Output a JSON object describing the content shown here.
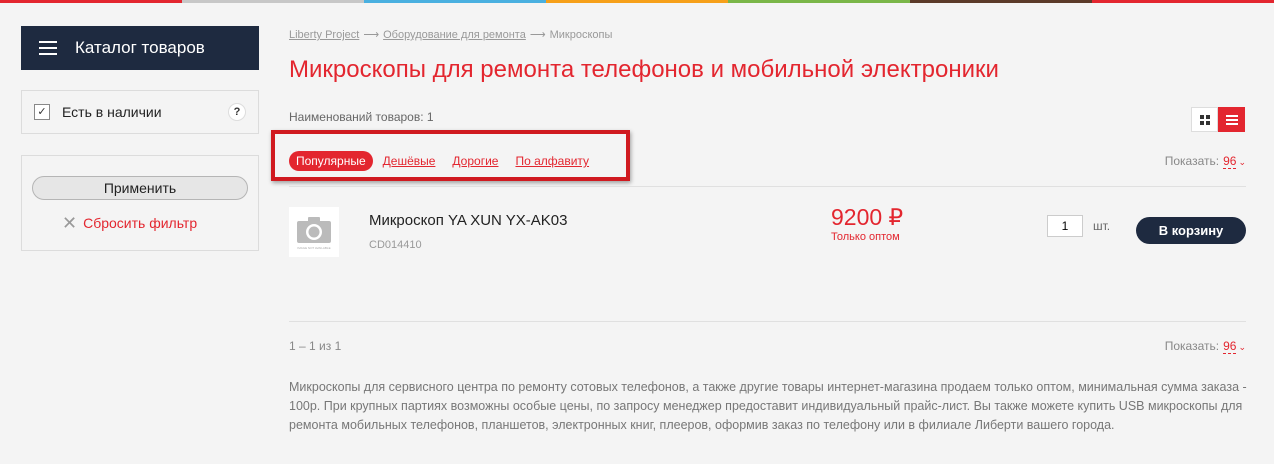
{
  "top_stripe_colors": [
    "#e3262f",
    "#c7c7c7",
    "#4ab0e0",
    "#f6a01a",
    "#7ab648",
    "#5b3a29",
    "#e3262f"
  ],
  "sidebar": {
    "catalog_label": "Каталог товаров",
    "in_stock_label": "Есть в наличии",
    "in_stock_checked": "✓",
    "help_label": "?",
    "apply_label": "Применить",
    "reset_label": "Сбросить фильтр"
  },
  "breadcrumb": {
    "items": [
      "Liberty Project",
      "Оборудование для ремонта",
      "Микроскопы"
    ],
    "separator": "⟶"
  },
  "page_title": "Микроскопы для ремонта телефонов и мобильной электроники",
  "product_count": "Наименований товаров: 1",
  "sort": {
    "active": "Популярные",
    "options": [
      "Дешёвые",
      "Дорогие",
      "По алфавиту"
    ]
  },
  "show": {
    "label": "Показать:",
    "value": "96",
    "chevron": "⌄"
  },
  "product": {
    "image_placeholder_text": "IMAGE NOT AVAILABLE",
    "name": "Микроскоп YA XUN YX-AK03",
    "code": "CD014410",
    "price": "9200 ₽",
    "wholesale_note": "Только оптом",
    "quantity": "1",
    "unit": "шт.",
    "cart_label": "В корзину"
  },
  "pager_text": "1 – 1 из 1",
  "description": "Микроскопы для сервисного центра по ремонту сотовых телефонов, а также другие товары интернет-магазина продаем только оптом, минимальная сумма заказа - 100р. При крупных партиях возможны особые цены, по запросу менеджер предоставит индивидуальный прайс-лист. Вы также можете купить USB микроскопы для ремонта мобильных телефонов, планшетов, электронных книг, плееров, оформив заказ по телефону или в филиале Либерти вашего города.",
  "colors": {
    "accent": "#e3262f",
    "dark": "#1e2a40"
  }
}
